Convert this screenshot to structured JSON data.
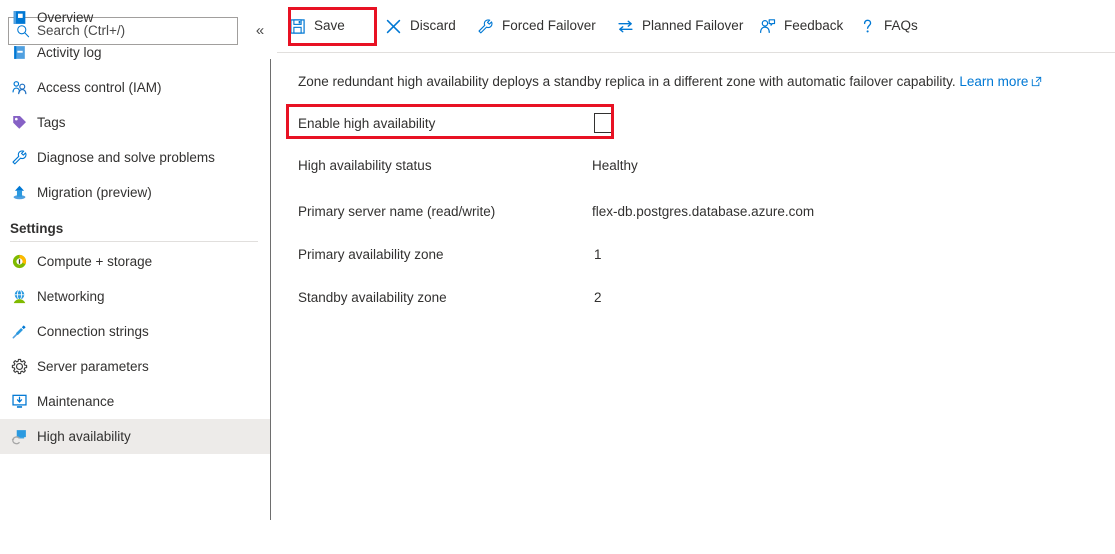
{
  "sidebar": {
    "search": {
      "placeholder": "Search (Ctrl+/)",
      "icon": "search-icon"
    },
    "collapse": {
      "label": "«",
      "icon": "chevron-double-left-icon"
    },
    "items": [
      {
        "label": "Overview",
        "icon": "overview-icon",
        "selected": false
      },
      {
        "label": "Activity log",
        "icon": "activity-log-icon",
        "selected": false
      },
      {
        "label": "Access control (IAM)",
        "icon": "access-control-icon",
        "selected": false
      },
      {
        "label": "Tags",
        "icon": "tags-icon",
        "selected": false
      },
      {
        "label": "Diagnose and solve problems",
        "icon": "wrench-icon",
        "selected": false
      },
      {
        "label": "Migration (preview)",
        "icon": "migration-icon",
        "selected": false
      }
    ],
    "settings_section": {
      "header": "Settings",
      "items": [
        {
          "label": "Compute + storage",
          "icon": "compute-storage-icon",
          "selected": false
        },
        {
          "label": "Networking",
          "icon": "networking-icon",
          "selected": false
        },
        {
          "label": "Connection strings",
          "icon": "connection-strings-icon",
          "selected": false
        },
        {
          "label": "Server parameters",
          "icon": "gear-icon",
          "selected": false
        },
        {
          "label": "Maintenance",
          "icon": "maintenance-icon",
          "selected": false
        },
        {
          "label": "High availability",
          "icon": "high-availability-icon",
          "selected": true
        }
      ]
    }
  },
  "toolbar": {
    "commands": [
      {
        "label": "Save",
        "icon": "save-icon",
        "highlighted": true
      },
      {
        "label": "Discard",
        "icon": "discard-x-icon",
        "highlighted": false
      },
      {
        "label": "Forced Failover",
        "icon": "wrench-icon",
        "highlighted": false
      },
      {
        "label": "Planned Failover",
        "icon": "swap-arrows-icon",
        "highlighted": false
      },
      {
        "label": "Feedback",
        "icon": "feedback-person-icon",
        "highlighted": false
      },
      {
        "label": "FAQs",
        "icon": "question-mark-icon",
        "highlighted": false
      }
    ]
  },
  "main": {
    "description": {
      "text": "Zone redundant high availability deploys a standby replica in a different zone with automatic failover capability.",
      "link_label": "Learn more",
      "link_icon": "external-link-icon"
    },
    "enable_ha": {
      "label": "Enable high availability",
      "checked": false,
      "highlighted": true
    },
    "fields": [
      {
        "label": "High availability status",
        "value": "Healthy"
      },
      {
        "label": "Primary server name (read/write)",
        "value": "flex-db.postgres.database.azure.com"
      },
      {
        "label": "Primary availability zone",
        "value": "1"
      },
      {
        "label": "Standby availability zone",
        "value": "2"
      }
    ]
  },
  "colors": {
    "accent": "#0078d4",
    "highlight_box": "#e81123",
    "selected_row": "#edebe9",
    "text": "#323130"
  }
}
